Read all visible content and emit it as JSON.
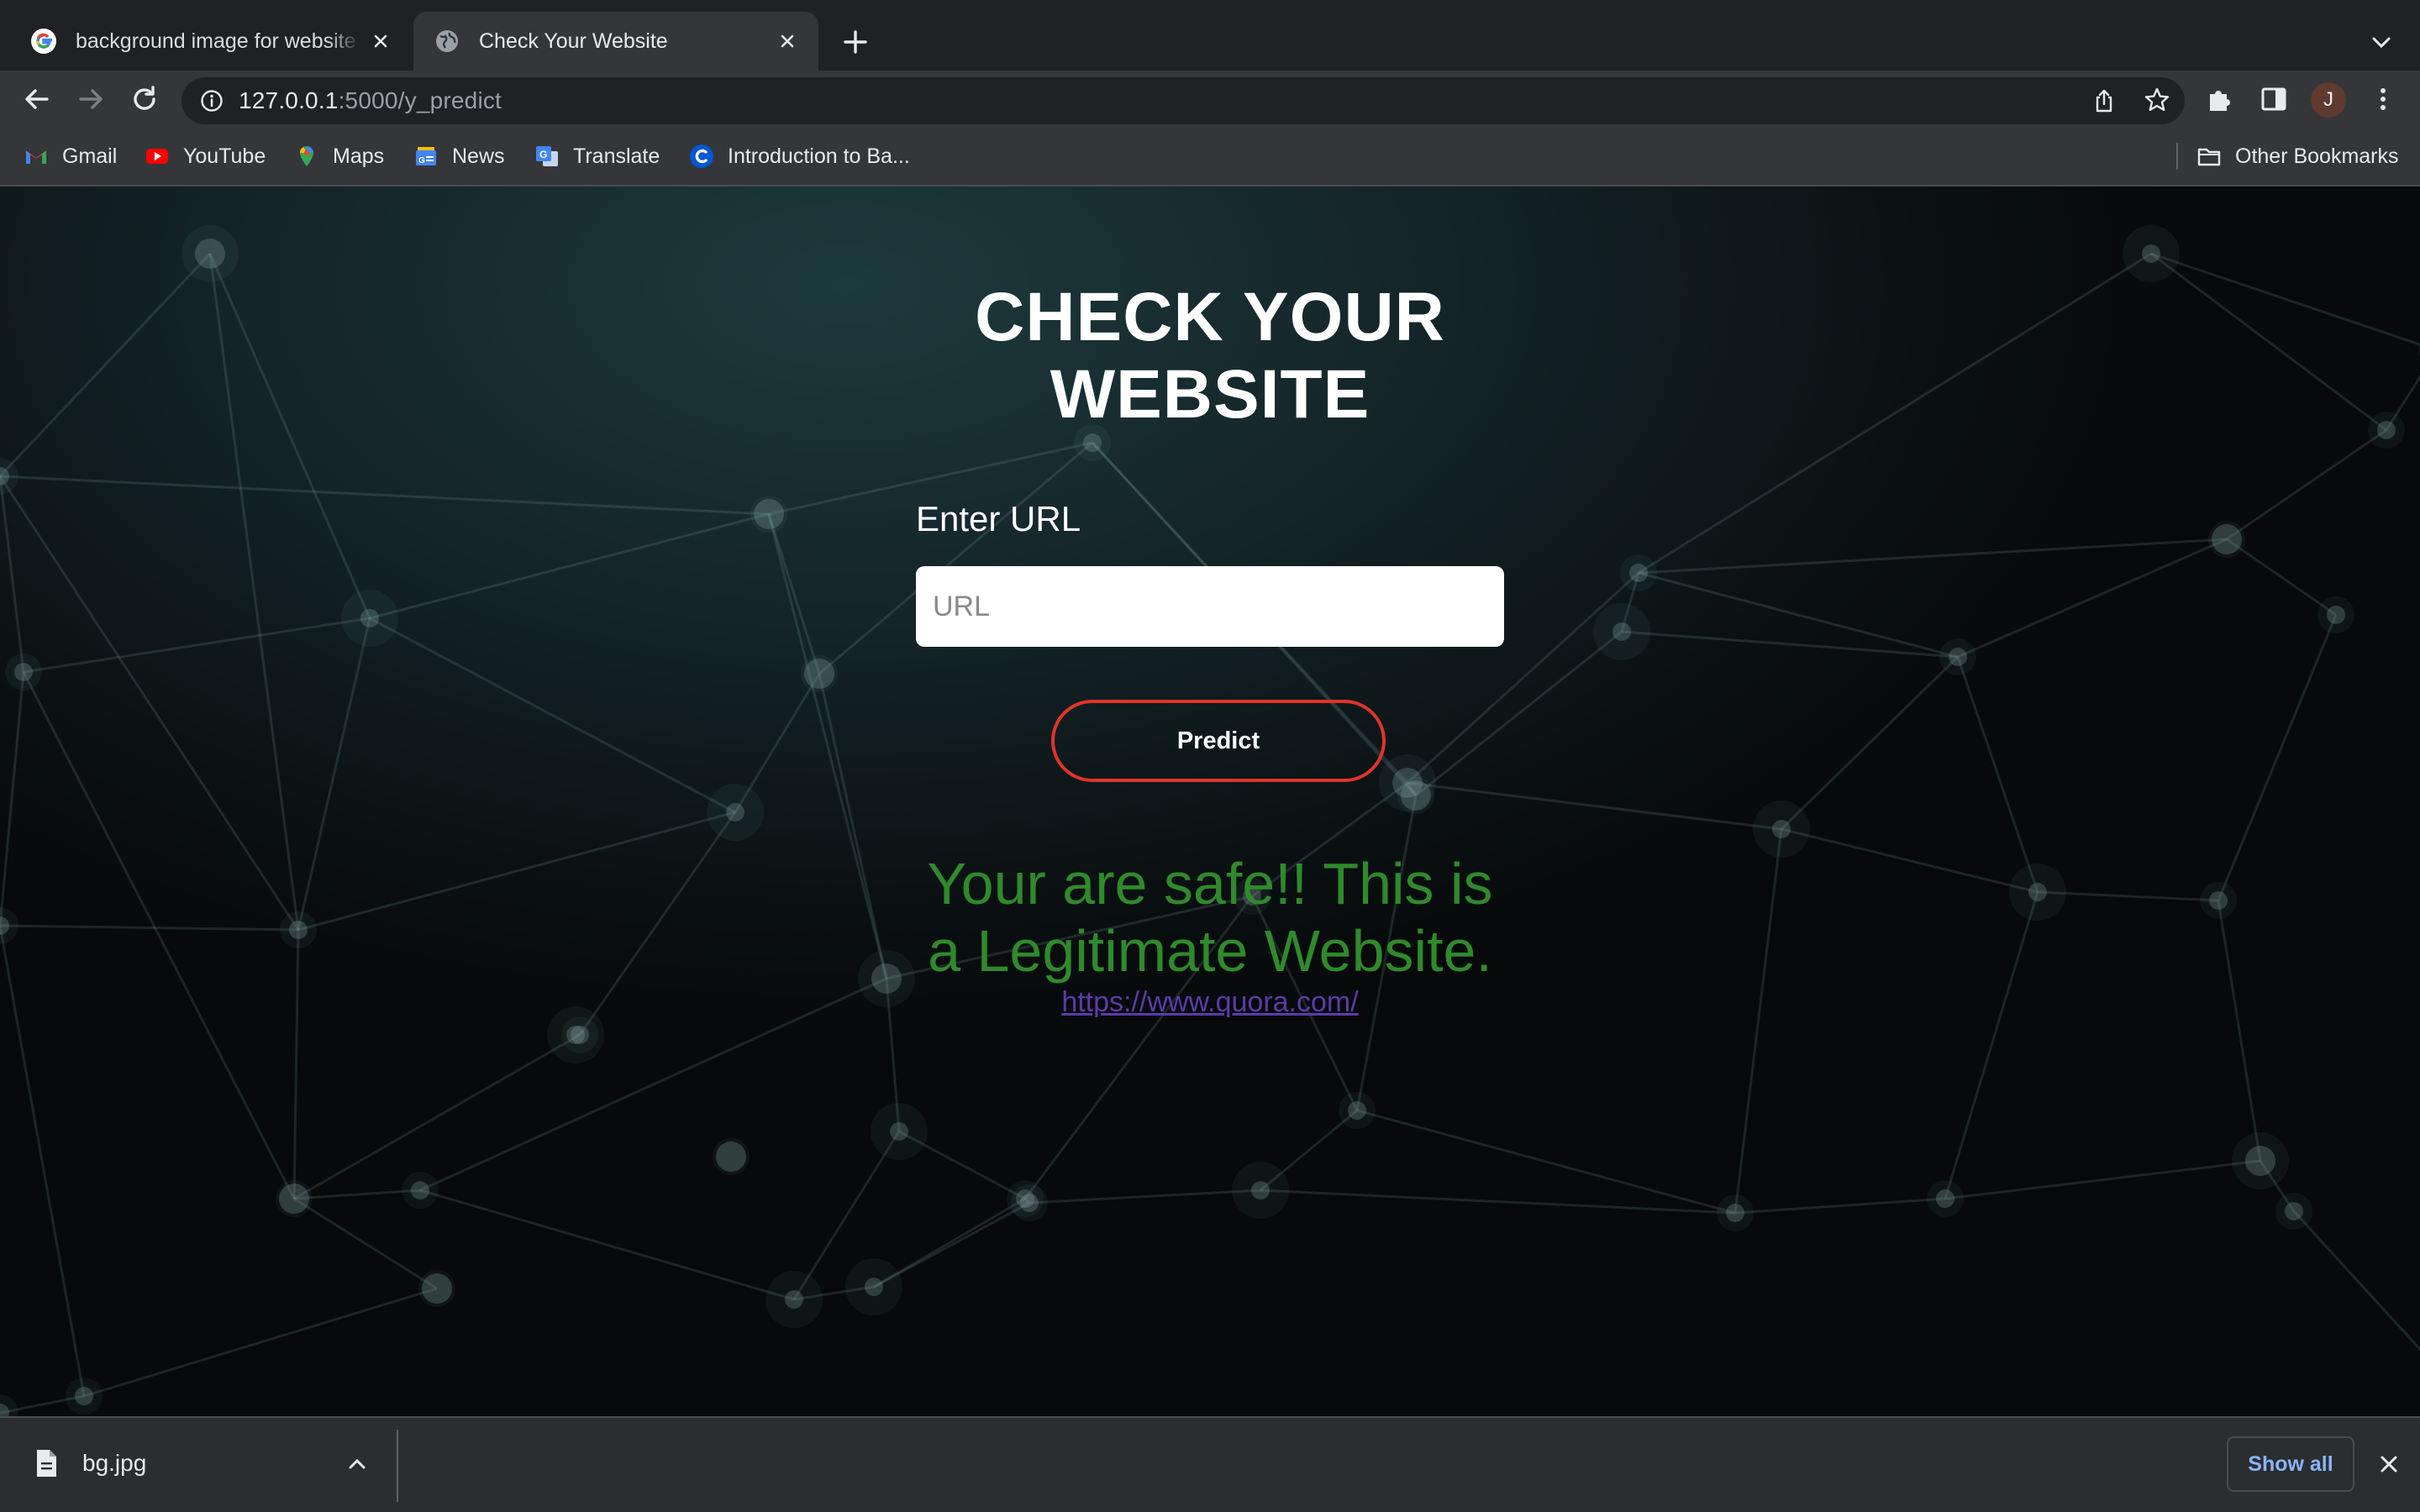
{
  "browser": {
    "tabs": [
      {
        "title": "background image for website",
        "favicon": "google-icon",
        "active": false
      },
      {
        "title": "Check Your Website",
        "favicon": "globe-icon",
        "active": true
      }
    ],
    "address": {
      "host": "127.0.0.1",
      "path": ":5000/y_predict"
    },
    "profile_initial": "J",
    "bookmarks": [
      {
        "label": "Gmail",
        "icon": "gmail-icon"
      },
      {
        "label": "YouTube",
        "icon": "youtube-icon"
      },
      {
        "label": "Maps",
        "icon": "maps-icon"
      },
      {
        "label": "News",
        "icon": "news-icon"
      },
      {
        "label": "Translate",
        "icon": "translate-icon"
      },
      {
        "label": "Introduction to Ba...",
        "icon": "coursera-icon"
      }
    ],
    "other_bookmarks": "Other Bookmarks"
  },
  "page": {
    "heading_line1": "CHECK YOUR",
    "heading_line2": "WEBSITE",
    "input_label": "Enter URL",
    "input_placeholder": "URL",
    "input_value": "",
    "predict_label": "Predict",
    "result_line1": "Your are safe!! This is",
    "result_line2": "a Legitimate Website.",
    "result_link": "https://www.quora.com/",
    "colors": {
      "result": "#2f8a2b",
      "link": "#5b3ba8",
      "button_border": "#e0342a"
    }
  },
  "downloads": {
    "file_name": "bg.jpg",
    "show_all": "Show all"
  }
}
